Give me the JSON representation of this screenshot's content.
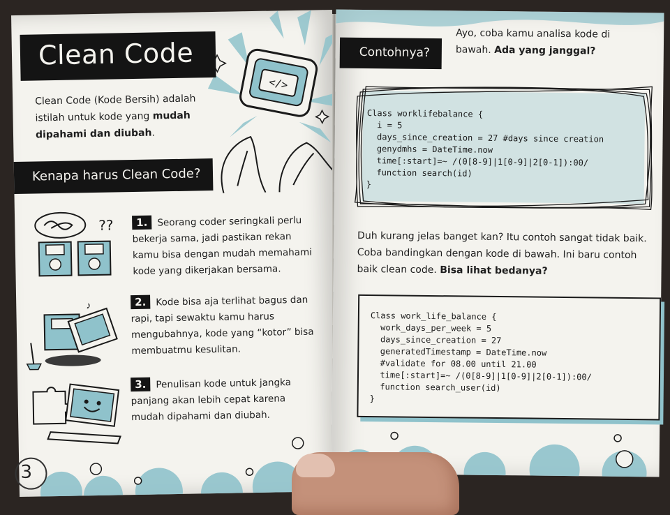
{
  "left_page": {
    "title": "Clean Code",
    "intro": {
      "text_1": "Clean Code (Kode Bersih) adalah istilah untuk kode yang ",
      "bold_1": "mudah dipahami dan diubah",
      "text_2": "."
    },
    "section_heading": "Kenapa harus Clean Code?",
    "points": [
      {
        "number": "1.",
        "text": "Seorang coder seringkali perlu bekerja sama, jadi pastikan rekan kamu bisa dengan mudah memahami kode yang dikerjakan bersama."
      },
      {
        "number": "2.",
        "text": "Kode bisa aja terlihat bagus dan rapi, tapi sewaktu kamu harus mengubahnya, kode yang “kotor” bisa membuatmu kesulitan."
      },
      {
        "number": "3.",
        "text": "Penulisan kode untuk jangka panjang akan lebih cepat karena mudah dipahami dan diubah."
      }
    ],
    "page_number": "3"
  },
  "right_page": {
    "example_label": "Contohnya?",
    "prompt": {
      "text": "Ayo, coba kamu analisa kode di bawah. ",
      "bold": "Ada yang janggal?"
    },
    "bad_code": "Class worklifebalance {\n  i = 5\n  days_since_creation = 27 #days since creation\n  genydmhs = DateTime.now\n  time[:start]=~ /(0[8-9]|1[0-9]|2[0-1]):00/\n  function search(id)\n}",
    "compare": {
      "text": "Duh kurang jelas banget kan? Itu contoh sangat tidak baik. Coba bandingkan dengan kode di bawah. Ini baru contoh baik clean code. ",
      "bold": "Bisa lihat bedanya?"
    },
    "good_code": "Class work_life_balance {\n  work_days_per_week = 5\n  days_since_creation = 27\n  generatedTimestamp = DateTime.now\n  #validate for 08.00 until 21.00\n  time[:start]=~ /(0[8-9]|1[0-9]|2[0-1]):00/\n  function search_user(id)\n}"
  },
  "colors": {
    "accent": "#8fc2cb",
    "label_bg": "#141414",
    "paper": "#f4f3ee"
  },
  "icons": [
    "monitor-code-icon",
    "sparkle-icon",
    "hands-illustration",
    "confused-floppy-illustration",
    "messy-computer-illustration",
    "happy-puzzle-laptop-illustration",
    "bubble-decoration"
  ]
}
